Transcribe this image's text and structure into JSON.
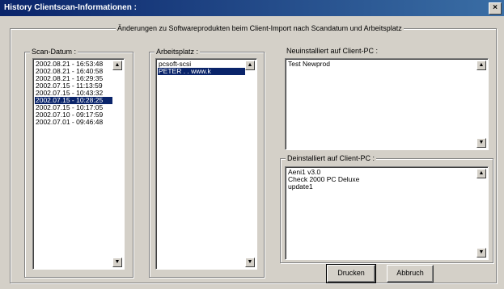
{
  "window": {
    "title": "History Clientscan-Informationen :",
    "close_glyph": "×"
  },
  "main_group": {
    "label": "Änderungen zu Softwareprodukten beim Client-Import nach Scandatum und Arbeitsplatz"
  },
  "scan_dates": {
    "label": "Scan-Datum :",
    "items": [
      "2002.08.21 - 16:53:48",
      "2002.08.21 - 16:40:58",
      "2002.08.21 - 16:29:35",
      "2002.07.15 - 11:13:59",
      "2002.07.15 - 10:43:32",
      "2002.07.15 - 10:28:25",
      "2002.07.15 - 10:17:05",
      "2002.07.10 - 09:17:59",
      "2002.07.01 - 09:46:48"
    ],
    "selected_index": 5
  },
  "workstations": {
    "label": "Arbeitsplatz :",
    "items": [
      "pcsoft-scsi",
      "PETER . . www.k"
    ],
    "selected_index": 1
  },
  "new_installed": {
    "label": "Neuinstalliert auf Client-PC :",
    "items": [
      "Test Newprod"
    ]
  },
  "uninstalled": {
    "label": "Deinstalliert auf Client-PC :",
    "items": [
      "Aeni1 v3.0",
      "Check 2000 PC Deluxe",
      "update1"
    ]
  },
  "buttons": {
    "print": "Drucken",
    "cancel": "Abbruch"
  },
  "scroll": {
    "up": "▲",
    "down": "▼"
  }
}
